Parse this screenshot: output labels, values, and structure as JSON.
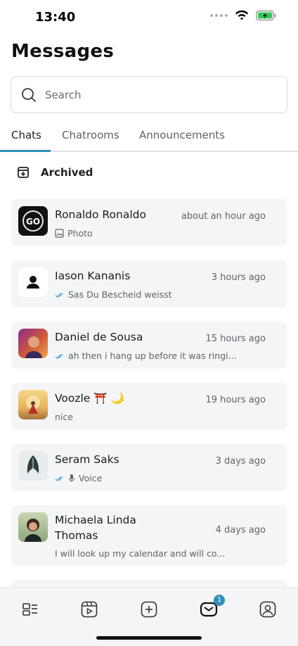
{
  "status_bar": {
    "time": "13:40"
  },
  "header": {
    "title": "Messages"
  },
  "search": {
    "placeholder": "Search"
  },
  "tabs": [
    {
      "label": "Chats",
      "active": true
    },
    {
      "label": "Chatrooms",
      "active": false
    },
    {
      "label": "Announcements",
      "active": false
    }
  ],
  "archived": {
    "label": "Archived"
  },
  "chats": [
    {
      "name": "Ronaldo Ronaldo",
      "time": "about an hour ago",
      "preview": "Photo",
      "preview_icon": "photo-icon",
      "read": false
    },
    {
      "name": "Iason Kananis",
      "time": "3 hours ago",
      "preview": "Sas Du Bescheid weisst",
      "preview_icon": "double-check-icon",
      "read": true
    },
    {
      "name": "Daniel de Sousa",
      "time": "15 hours ago",
      "preview": "ah then i hang up before it was ringi...",
      "preview_icon": "double-check-icon",
      "read": true
    },
    {
      "name": "Voozle ⛩️ 🌙",
      "time": "19 hours ago",
      "preview": "nice",
      "preview_icon": "",
      "read": false
    },
    {
      "name": "Seram Saks",
      "time": "3 days ago",
      "preview": "Voice",
      "preview_icon": "microphone-icon",
      "read": true
    },
    {
      "name": "Michaela Linda Thomas",
      "time": "4 days ago",
      "preview": "I will look up my calendar and will co...",
      "preview_icon": "",
      "read": false
    }
  ],
  "tab_bar": {
    "items": [
      {
        "icon": "feed-icon"
      },
      {
        "icon": "video-icon"
      },
      {
        "icon": "add-icon"
      },
      {
        "icon": "messages-icon",
        "badge": "1"
      },
      {
        "icon": "profile-icon"
      }
    ]
  },
  "colors": {
    "accent": "#2f8fb8",
    "card_bg": "#f4f5f7",
    "check": "#4aa3d8"
  }
}
